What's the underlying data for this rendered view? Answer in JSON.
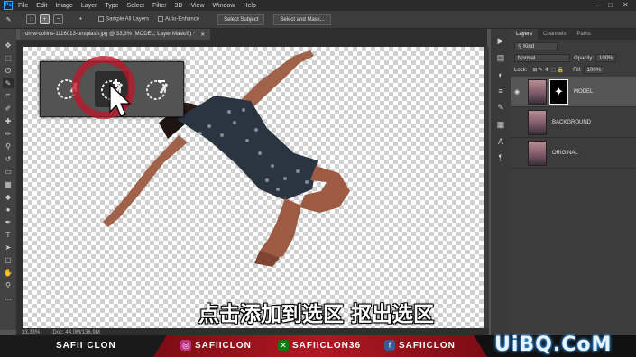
{
  "menubar": {
    "logo": "Ps",
    "items": [
      "File",
      "Edit",
      "Image",
      "Layer",
      "Type",
      "Select",
      "Filter",
      "3D",
      "View",
      "Window",
      "Help"
    ]
  },
  "options": {
    "sample_all_layers": "Sample All Layers",
    "auto_enhance": "Auto-Enhance",
    "select_subject": "Select Subject",
    "select_and_mask": "Select and Mask..."
  },
  "document": {
    "tab_title": "dmw-collins-1116013-unsplash.jpg @ 33,3% (MODEL, Layer Mask/8) *"
  },
  "statusbar": {
    "zoom": "33,33%",
    "doc": "Doc: 44,0M/136,9M"
  },
  "panel": {
    "tabs": [
      "Layers",
      "Channels",
      "Paths"
    ],
    "kind": "Kind",
    "blend_mode": "Normal",
    "opacity_label": "Opacity:",
    "opacity_value": "100%",
    "lock_label": "Lock:",
    "fill_label": "Fill:",
    "fill_value": "100%",
    "layers": [
      {
        "name": "MODEL",
        "selected": true,
        "visible": true,
        "has_mask": true
      },
      {
        "name": "BACKGROUND",
        "selected": false,
        "visible": false,
        "has_mask": false
      },
      {
        "name": "ORIGINAL",
        "selected": false,
        "visible": false,
        "has_mask": false
      }
    ]
  },
  "subtitle": "点击添加到选区 抠出选区",
  "banner": {
    "name": "SAFII CLON",
    "instagram": "SAFIICLON",
    "xbox": "SAFIICLON36",
    "facebook": "SAFIICLON"
  },
  "watermark": "UiBQ.CoM",
  "colors": {
    "accent_red": "#b01822",
    "ps_blue": "#31a8ff"
  }
}
